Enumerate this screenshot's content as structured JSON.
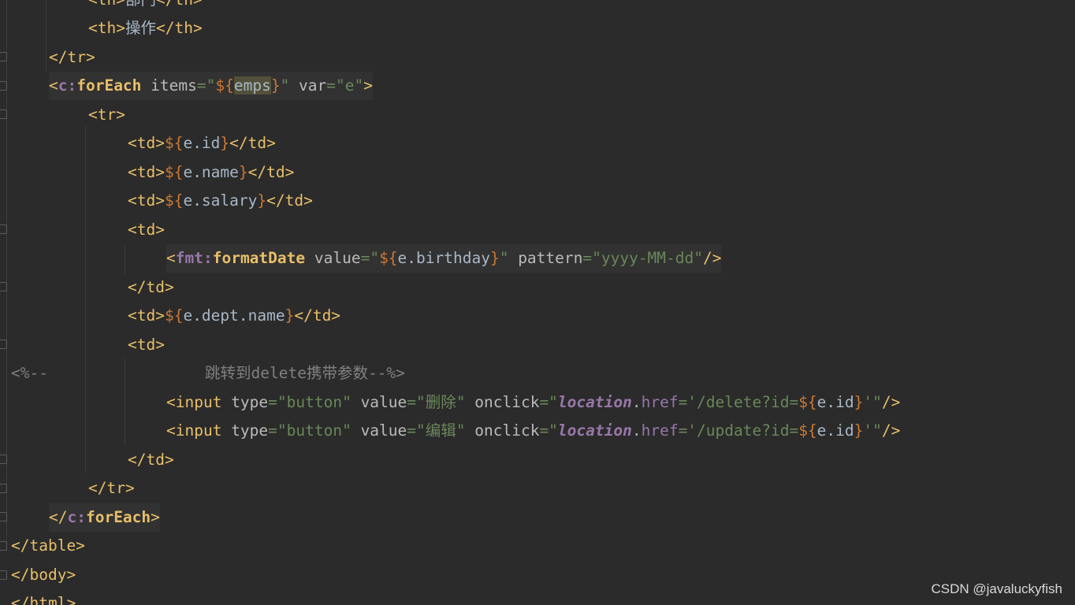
{
  "code_lines": [
    [
      [
        "c-tag",
        "<th>"
      ],
      [
        "c-text",
        "部门"
      ],
      [
        "c-tag",
        "</th>"
      ]
    ],
    [
      [
        "c-tag",
        "<th>"
      ],
      [
        "c-text",
        "操作"
      ],
      [
        "c-tag",
        "</th>"
      ]
    ],
    [
      [
        "c-tag",
        "</tr>"
      ]
    ],
    [
      [
        "c-tag",
        "<"
      ],
      [
        "c-ns",
        "c:"
      ],
      [
        "c-ntag",
        "forEach"
      ],
      [
        "c-attr",
        " items"
      ],
      [
        "c-str",
        "=\""
      ],
      [
        "c-el",
        "${"
      ],
      [
        "c-text",
        "emps",
        "hl-emps"
      ],
      [
        "c-el",
        "}"
      ],
      [
        "c-str",
        "\""
      ],
      [
        "c-attr",
        " var"
      ],
      [
        "c-str",
        "=\"e\""
      ],
      [
        "c-tag",
        ">"
      ]
    ],
    [
      [
        "c-tag",
        "<tr>"
      ]
    ],
    [
      [
        "c-tag",
        "<td>"
      ],
      [
        "c-el",
        "${"
      ],
      [
        "c-text",
        "e.id"
      ],
      [
        "c-el",
        "}"
      ],
      [
        "c-tag",
        "</td>"
      ]
    ],
    [
      [
        "c-tag",
        "<td>"
      ],
      [
        "c-el",
        "${"
      ],
      [
        "c-text",
        "e.name"
      ],
      [
        "c-el",
        "}"
      ],
      [
        "c-tag",
        "</td>"
      ]
    ],
    [
      [
        "c-tag",
        "<td>"
      ],
      [
        "c-el",
        "${"
      ],
      [
        "c-text",
        "e.salary"
      ],
      [
        "c-el",
        "}"
      ],
      [
        "c-tag",
        "</td>"
      ]
    ],
    [
      [
        "c-tag",
        "<td>"
      ]
    ],
    [
      [
        "c-tag",
        "<"
      ],
      [
        "c-ns",
        "fmt:"
      ],
      [
        "c-ntag",
        "formatDate"
      ],
      [
        "c-attr",
        " value"
      ],
      [
        "c-str",
        "=\""
      ],
      [
        "c-el",
        "${"
      ],
      [
        "c-text",
        "e.birthday"
      ],
      [
        "c-el",
        "}"
      ],
      [
        "c-str",
        "\""
      ],
      [
        "c-attr",
        " pattern"
      ],
      [
        "c-str",
        "=\"yyyy-MM-dd\""
      ],
      [
        "c-tag",
        "/>"
      ]
    ],
    [
      [
        "c-tag",
        "</td>"
      ]
    ],
    [
      [
        "c-tag",
        "<td>"
      ],
      [
        "c-el",
        "${"
      ],
      [
        "c-text",
        "e.dept.name"
      ],
      [
        "c-el",
        "}"
      ],
      [
        "c-tag",
        "</td>"
      ]
    ],
    [
      [
        "c-tag",
        "<td>"
      ]
    ],
    [
      [
        "c-cmt",
        "跳转到delete携带参数--%>"
      ]
    ],
    [
      [
        "c-tag",
        "<input"
      ],
      [
        "c-attr",
        " type"
      ],
      [
        "c-str",
        "=\"button\""
      ],
      [
        "c-attr",
        " value"
      ],
      [
        "c-str",
        "=\"删除\""
      ],
      [
        "c-attr",
        " onclick"
      ],
      [
        "c-str",
        "=\""
      ],
      [
        "c-js",
        "location"
      ],
      [
        "c-dot",
        "."
      ],
      [
        "c-prop",
        "href"
      ],
      [
        "c-str",
        "='/delete?id="
      ],
      [
        "c-el",
        "${"
      ],
      [
        "c-text",
        "e.id"
      ],
      [
        "c-el",
        "}"
      ],
      [
        "c-str",
        "'\""
      ],
      [
        "c-tag",
        "/>"
      ]
    ],
    [
      [
        "c-tag",
        "<input"
      ],
      [
        "c-attr",
        " type"
      ],
      [
        "c-str",
        "=\"button\""
      ],
      [
        "c-attr",
        " value"
      ],
      [
        "c-str",
        "=\"编辑\""
      ],
      [
        "c-attr",
        " onclick"
      ],
      [
        "c-str",
        "=\""
      ],
      [
        "c-js",
        "location"
      ],
      [
        "c-dot",
        "."
      ],
      [
        "c-prop",
        "href"
      ],
      [
        "c-str",
        "='/update?id="
      ],
      [
        "c-el",
        "${"
      ],
      [
        "c-text",
        "e.id"
      ],
      [
        "c-el",
        "}"
      ],
      [
        "c-str",
        "'\""
      ],
      [
        "c-tag",
        "/>"
      ]
    ],
    [
      [
        "c-tag",
        "</td>"
      ]
    ],
    [
      [
        "c-tag",
        "</tr>"
      ]
    ],
    [
      [
        "c-tag",
        "</"
      ],
      [
        "c-ns",
        "c:"
      ],
      [
        "c-ntag",
        "forEach"
      ],
      [
        "c-tag",
        ">"
      ]
    ],
    [
      [
        "c-tag",
        "</table>"
      ]
    ],
    [
      [
        "c-tag",
        "</body>"
      ]
    ],
    [
      [
        "c-tag",
        "</html>"
      ]
    ]
  ],
  "comment_prefix": "<%--",
  "watermark": "CSDN @javaluckyfish"
}
